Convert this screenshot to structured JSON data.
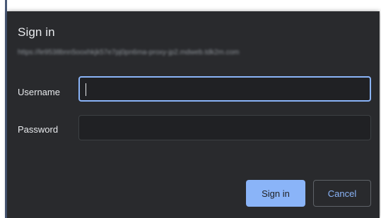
{
  "dialog": {
    "title": "Sign in",
    "url": "https://le9538bnn5ooxhkjk57e7pj0pn6ma-proxy-jp2.mdweb.tdk2m.com"
  },
  "form": {
    "username_label": "Username",
    "username_value": "",
    "password_label": "Password",
    "password_value": ""
  },
  "buttons": {
    "signin_label": "Sign in",
    "cancel_label": "Cancel"
  },
  "colors": {
    "dialog_bg": "#292a2d",
    "input_bg": "#202124",
    "accent": "#8ab4f8",
    "text": "#e8eaed"
  }
}
